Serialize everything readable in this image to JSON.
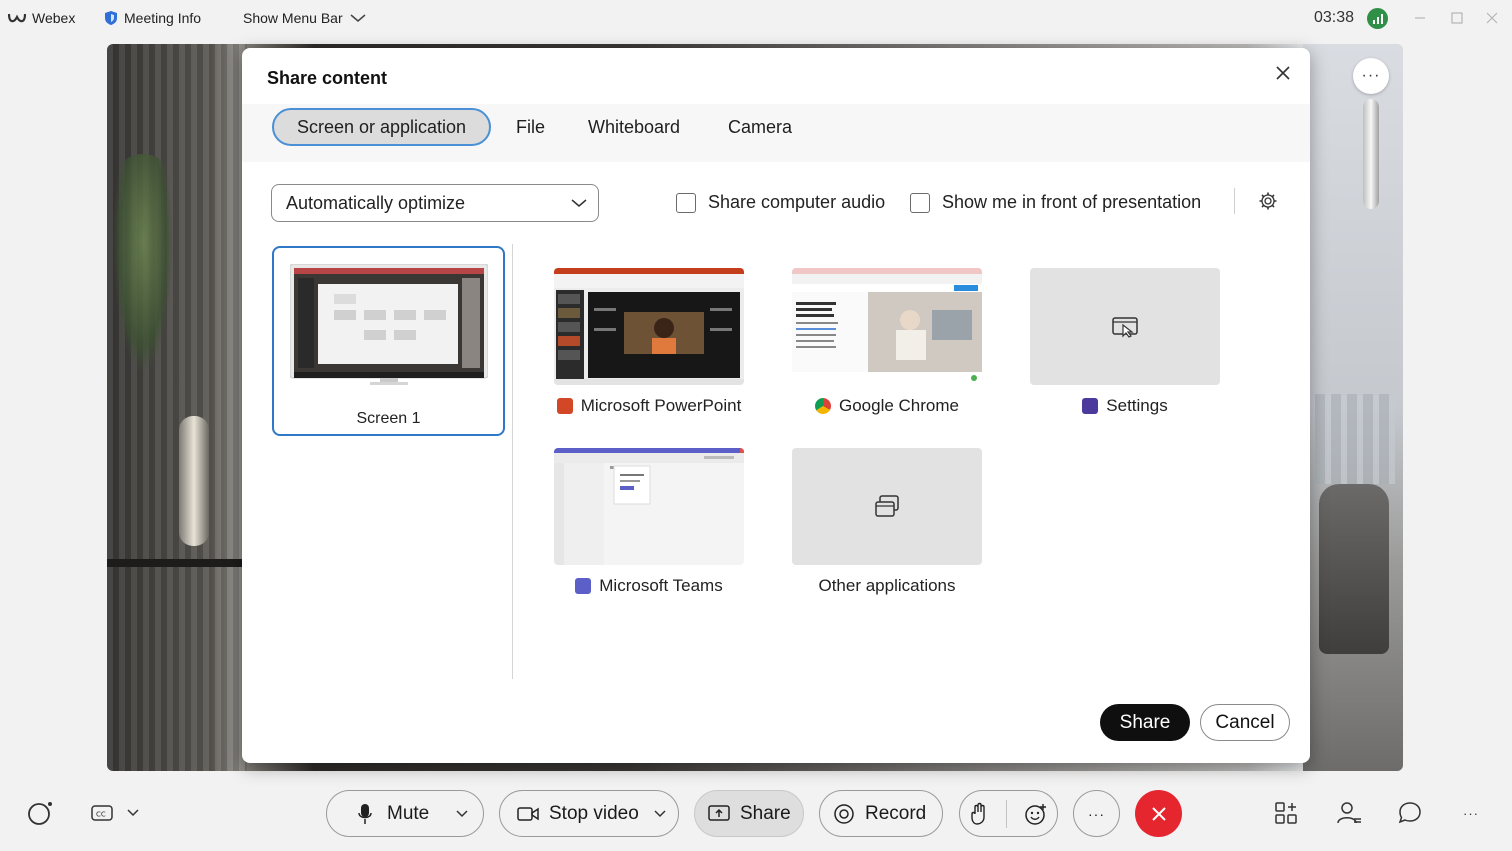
{
  "titlebar": {
    "app_name": "Webex",
    "meeting_info": "Meeting Info",
    "menu_toggle": "Show Menu Bar",
    "clock": "03:38"
  },
  "dialog": {
    "title": "Share content",
    "tabs": [
      {
        "label": "Screen or application",
        "active": true
      },
      {
        "label": "File",
        "active": false
      },
      {
        "label": "Whiteboard",
        "active": false
      },
      {
        "label": "Camera",
        "active": false
      }
    ],
    "optimize_select": "Automatically optimize",
    "checkbox_audio": "Share computer audio",
    "checkbox_front": "Show me in front of presentation",
    "screens": [
      {
        "label": "Screen 1",
        "selected": true
      }
    ],
    "apps": [
      {
        "label": "Microsoft PowerPoint",
        "icon": "powerpoint-icon",
        "color": "#d24726"
      },
      {
        "label": "Google Chrome",
        "icon": "chrome-icon",
        "color": "#4285f4"
      },
      {
        "label": "Settings",
        "icon": "settings-app-icon",
        "color": "#4b3a9c"
      },
      {
        "label": "Microsoft Teams",
        "icon": "teams-icon",
        "color": "#5b5fc7"
      },
      {
        "label": "Other applications",
        "icon": "other-apps-icon",
        "color": ""
      }
    ],
    "share_button": "Share",
    "cancel_button": "Cancel"
  },
  "controls": {
    "mute": "Mute",
    "stop_video": "Stop video",
    "share": "Share",
    "record": "Record"
  },
  "colors": {
    "accent": "#2e78c7",
    "end_call": "#e5262f",
    "network_ok": "#2f8f46"
  }
}
